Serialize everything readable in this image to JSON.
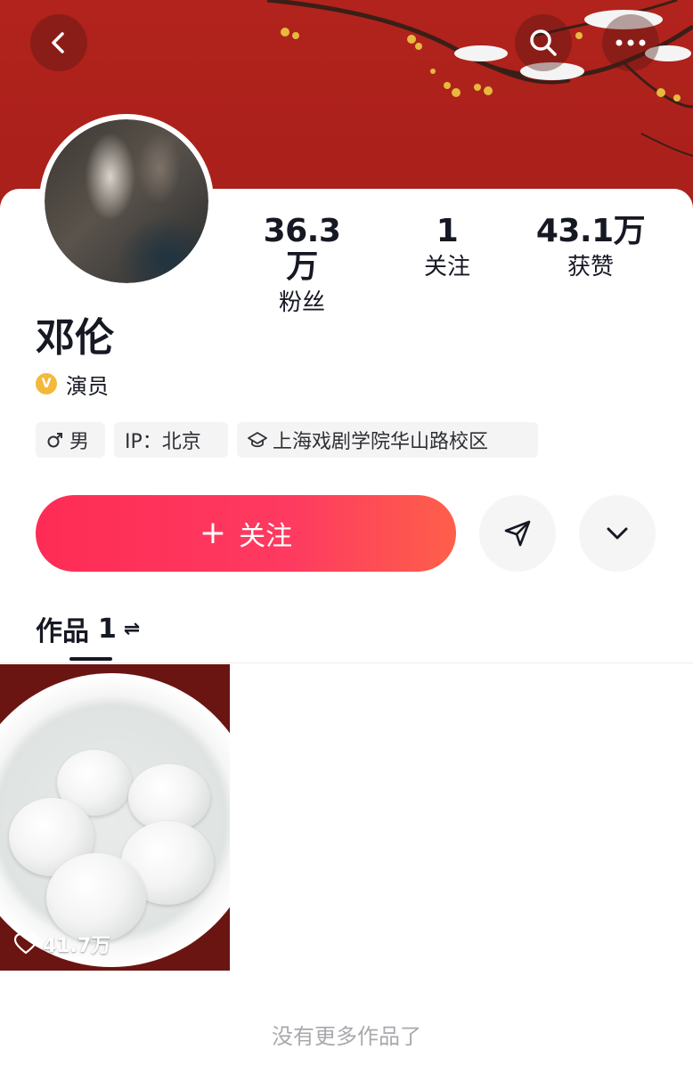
{
  "profile": {
    "name": "邓伦",
    "verification": "演员",
    "verify_badge": "V",
    "stats": [
      {
        "value": "36.3万",
        "label": "粉丝"
      },
      {
        "value": "1",
        "label": "关注"
      },
      {
        "value": "43.1万",
        "label": "获赞"
      }
    ],
    "tags": {
      "gender": "男",
      "ip": "IP：北京",
      "school": "上海戏剧学院华山路校区"
    }
  },
  "actions": {
    "follow_plus": "+",
    "follow_label": "关注"
  },
  "tabs": {
    "works_label": "作品",
    "works_count": "1",
    "swap_symbol": "⇌"
  },
  "works": [
    {
      "likes": "41.7万"
    }
  ],
  "footer": {
    "no_more": "没有更多作品了"
  },
  "colors": {
    "header_red": "#b2231d",
    "follow_gradient_start": "#fe2c55",
    "follow_gradient_end": "#fe5f4a",
    "verify_gold": "#f3b93a"
  },
  "icons": [
    "back-arrow-icon",
    "search-icon",
    "more-icon",
    "male-icon",
    "school-icon",
    "send-icon",
    "chevron-down-icon",
    "heart-icon"
  ]
}
